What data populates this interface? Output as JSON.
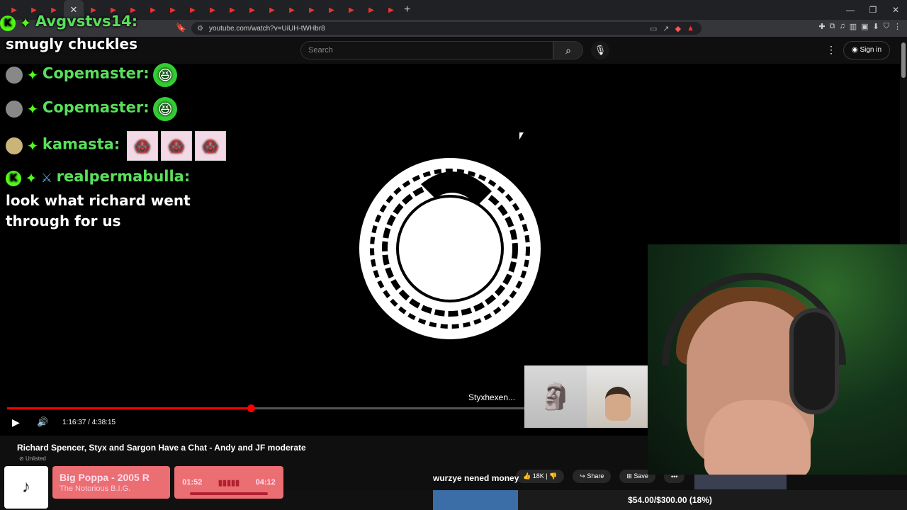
{
  "browser": {
    "url": "youtube.com/watch?v=UiUH-tWHbr8",
    "tab_count_icons": [
      "yt-icon",
      "yt-icon",
      "yt-icon",
      "yt-icon",
      "yt-icon",
      "yt-icon",
      "yt-icon",
      "yt-icon",
      "yt-icon",
      "yt-icon",
      "yt-icon",
      "yt-icon",
      "yt-icon",
      "yt-icon",
      "yt-icon",
      "yt-icon",
      "yt-icon",
      "yt-icon",
      "yt-icon",
      "yt-icon"
    ]
  },
  "youtube": {
    "search_placeholder": "Search",
    "signin_label": "Sign in",
    "video_title": "Richard Spencer, Styx and Sargon Have a Chat - Andy and JF moderate",
    "visibility": "Unlisted",
    "likes": "18K",
    "share_label": "Share",
    "save_label": "Save",
    "current_time": "1:16:37",
    "duration": "4:38:15",
    "progress": 0.38,
    "endcard_label": "Styxhexen..."
  },
  "chat": [
    {
      "user": "Avgvstvs14:",
      "message": "smugly chuckles",
      "badges": [
        "kick-badge",
        "gem-badge"
      ]
    },
    {
      "user": "Copemaster:",
      "message": "",
      "emotes": [
        "laugh-emote"
      ]
    },
    {
      "user": "Copemaster:",
      "message": "",
      "emotes": [
        "laugh-emote"
      ]
    },
    {
      "user": "kamasta:",
      "message": "",
      "emotes": [
        "scream-emote",
        "scream-emote",
        "scream-emote"
      ]
    },
    {
      "user": "realpermabulla:",
      "message": "look what richard went through for us",
      "badges": [
        "kick-badge",
        "gem-badge",
        "sword-badge"
      ]
    }
  ],
  "overlay": {
    "song_title": "Big Poppa - 2005 R",
    "song_artist": "The Notorious B.I.G.",
    "song_elapsed": "01:52",
    "song_total": "04:12",
    "donation_message": "wurzye nened money",
    "goal_text": "$54.00/$300.00 (18%)",
    "goal_fraction": 0.18
  },
  "colors": {
    "accent": "#ff0000",
    "chat_name": "#59e05b",
    "spotify_box": "#eb6e73",
    "goal_fill": "#3b6ea6"
  }
}
